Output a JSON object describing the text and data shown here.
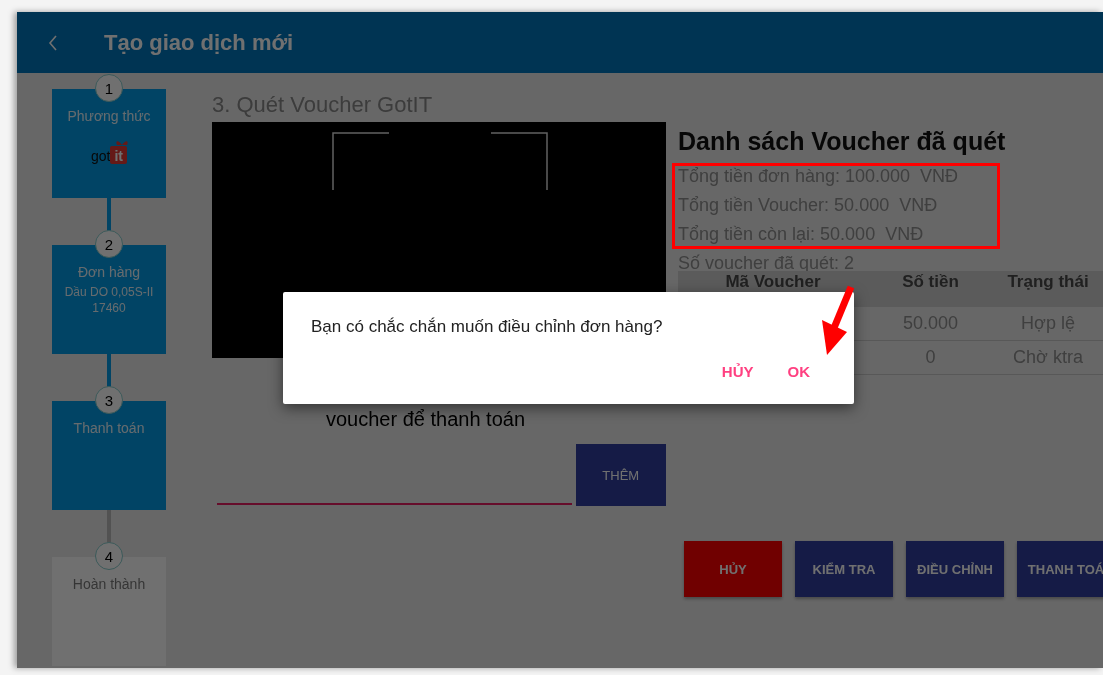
{
  "header": {
    "title": "Tạo giao dịch mới"
  },
  "steps": [
    {
      "number": "1",
      "label": "Phương thức",
      "enabled": true,
      "logo": {
        "word": "got",
        "tag": "it"
      }
    },
    {
      "number": "2",
      "label": "Đơn hàng",
      "details": [
        "Dầu DO 0,05S-II",
        "17460"
      ],
      "enabled": true
    },
    {
      "number": "3",
      "label": "Thanh toán",
      "enabled": true
    },
    {
      "number": "4",
      "label": "Hoàn thành",
      "enabled": false
    }
  ],
  "scanner": {
    "title": "3. Quét Voucher GotIT",
    "hint": "voucher để thanh toán",
    "add_button": "THÊM"
  },
  "voucher_list": {
    "title": "Danh sách Voucher đã quét",
    "summary": [
      "Tổng tiền đơn hàng: 100.000  VNĐ",
      "Tổng tiền Voucher: 50.000  VNĐ",
      "Tổng tiền còn lại: 50.000  VNĐ"
    ],
    "count": "Số voucher đã quét: 2",
    "columns": [
      "Mã Voucher",
      "Số tiền",
      "Trạng thái"
    ],
    "rows": [
      {
        "amount": "50.000",
        "status": "Hợp lệ"
      },
      {
        "amount": "0",
        "status": "Chờ ktra"
      }
    ]
  },
  "actions": [
    {
      "label": "HỦY",
      "kind": "danger"
    },
    {
      "label": "KIỂM TRA",
      "kind": "primary"
    },
    {
      "label": "ĐIỀU CHỈNH",
      "kind": "primary"
    },
    {
      "label": "THANH TOÁ",
      "kind": "primary"
    }
  ],
  "dialog": {
    "message": "Bạn có chắc chắn muốn điều chỉnh đơn hàng?",
    "buttons": [
      "HỦY",
      "OK"
    ]
  }
}
